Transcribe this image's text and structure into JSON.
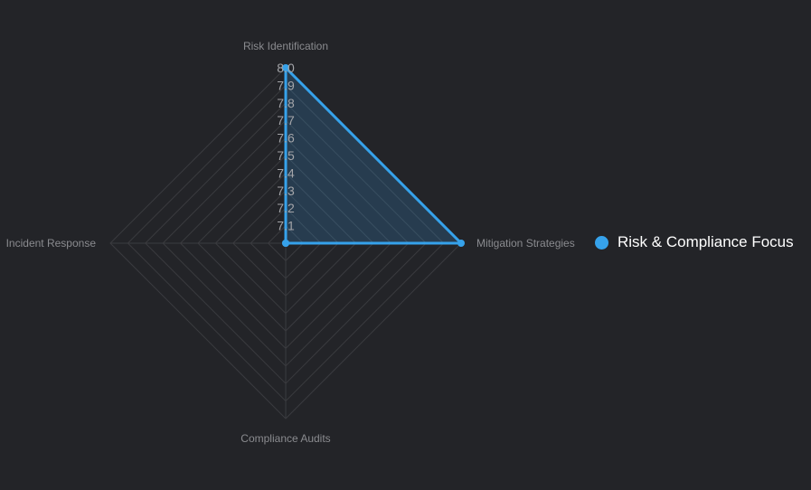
{
  "chart_data": {
    "type": "radar",
    "title": "",
    "axes": [
      "Risk Identification",
      "Mitigation Strategies",
      "Compliance Audits",
      "Incident Response"
    ],
    "series": [
      {
        "name": "Risk & Compliance Focus",
        "values": [
          8.0,
          8.0,
          7.0,
          7.0
        ],
        "color": "#36a2eb",
        "fill": "rgba(54,162,235,0.2)"
      }
    ],
    "r_range": [
      7.0,
      8.0
    ],
    "ticks": [
      "7.1",
      "7.2",
      "7.3",
      "7.4",
      "7.5",
      "7.6",
      "7.7",
      "7.8",
      "7.9",
      "8.0"
    ],
    "grid": true,
    "grid_color": "#3a3b3f",
    "legend_position": "right"
  }
}
